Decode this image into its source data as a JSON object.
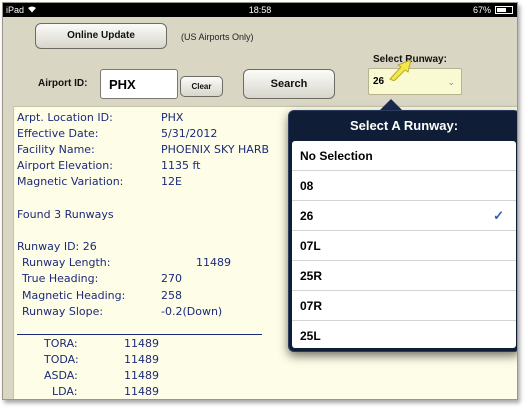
{
  "status_bar": {
    "device": "iPad",
    "time": "18:58",
    "battery": "67%",
    "battery_level": 0.67
  },
  "header": {
    "online_update_label": "Online Update",
    "online_note": "(US Airports Only)",
    "select_runway_label": "Select Runway:",
    "airport_id_label": "Airport ID:",
    "airport_id_value": "PHX",
    "clear_label": "Clear",
    "search_label": "Search",
    "runway_value": "26"
  },
  "results": {
    "loc_label": "Arpt. Location ID:",
    "loc_value": "PHX",
    "date_label": "Effective Date:",
    "date_value": "5/31/2012",
    "facility_label": "Facility Name:",
    "facility_value": "PHOENIX SKY HARB",
    "elev_label": "Airport Elevation:",
    "elev_value": "1135 ft",
    "magvar_label": "Magnetic Variation:",
    "magvar_value": "12E",
    "found": "Found 3 Runways",
    "runway_id": "Runway ID: 26",
    "length_label": "Runway Length:",
    "length_value": "11489",
    "true_label": "True Heading:",
    "true_value": "270",
    "mag_label": "Magnetic Heading:",
    "mag_value": "258",
    "slope_label": "Runway Slope:",
    "slope_value": "-0.2(Down)",
    "tora_label": "TORA:",
    "tora_value": "11489",
    "toda_label": "TODA:",
    "toda_value": "11489",
    "asda_label": "ASDA:",
    "asda_value": "11489",
    "lda_label": "LDA:",
    "lda_value": "11489"
  },
  "popover": {
    "title": "Select A Runway:",
    "options": [
      "No Selection",
      "08",
      "26",
      "07L",
      "25R",
      "07R",
      "25L"
    ],
    "checkmark": "✓",
    "selected_index": 2
  }
}
